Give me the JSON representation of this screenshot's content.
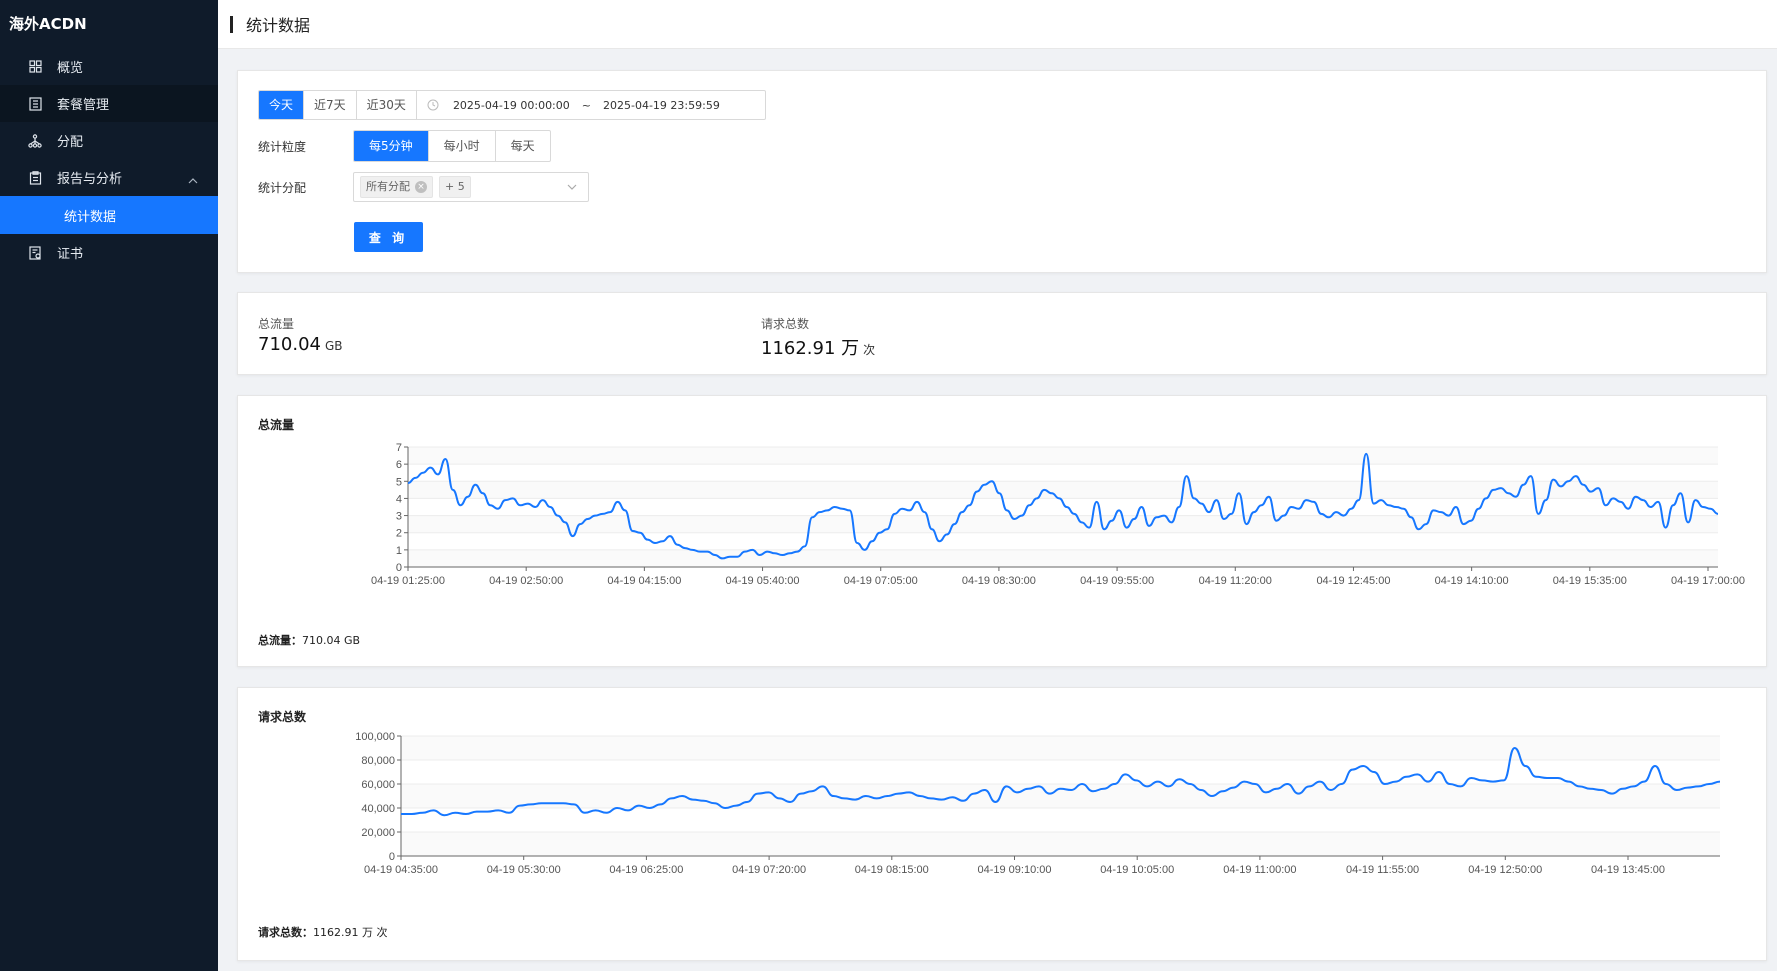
{
  "sidebar": {
    "brand": "海外ACDN",
    "items": [
      {
        "label": "概览",
        "icon": "grid-icon"
      },
      {
        "label": "套餐管理",
        "icon": "document-list-icon"
      },
      {
        "label": "分配",
        "icon": "hierarchy-icon"
      },
      {
        "label": "报告与分析",
        "icon": "clipboard-icon"
      },
      {
        "label": "统计数据",
        "icon": ""
      },
      {
        "label": "证书",
        "icon": "certificate-icon"
      }
    ]
  },
  "header": {
    "title": "统计数据"
  },
  "filters": {
    "ranges": [
      "今天",
      "近7天",
      "近30天"
    ],
    "start": "2025-04-19 00:00:00",
    "separator": "~",
    "end": "2025-04-19 23:59:59",
    "granularity_label": "统计粒度",
    "granularities": [
      "每5分钟",
      "每小时",
      "每天"
    ],
    "distribution_label": "统计分配",
    "distribution_tag": "所有分配",
    "distribution_more": "+ 5",
    "query_label": "查 询"
  },
  "summary": {
    "traffic_label": "总流量",
    "traffic_value": "710.04",
    "traffic_unit": "GB",
    "requests_label": "请求总数",
    "requests_value": "1162.91 万",
    "requests_unit": "次"
  },
  "chart_data": [
    {
      "type": "line",
      "title": "总流量",
      "ylim": [
        0,
        7
      ],
      "yticks": [
        "0",
        "1",
        "2",
        "3",
        "4",
        "5",
        "6",
        "7"
      ],
      "xticks": [
        "04-19 01:25:00",
        "04-19 02:50:00",
        "04-19 04:15:00",
        "04-19 05:40:00",
        "04-19 07:05:00",
        "04-19 08:30:00",
        "04-19 09:55:00",
        "04-19 11:20:00",
        "04-19 12:45:00",
        "04-19 14:10:00",
        "04-19 15:35:00",
        "04-19 17:00:00"
      ],
      "color": "#1677ff",
      "values": [
        4.9,
        5.2,
        5.5,
        5.8,
        5.4,
        6.3,
        4.5,
        3.6,
        4.1,
        4.8,
        4.3,
        3.6,
        3.4,
        3.9,
        4.0,
        3.6,
        3.7,
        3.5,
        3.9,
        3.5,
        3.0,
        2.6,
        1.8,
        2.5,
        2.8,
        3.0,
        3.1,
        3.2,
        3.8,
        3.3,
        2.1,
        2.0,
        1.6,
        1.4,
        1.5,
        1.8,
        1.3,
        1.1,
        1.0,
        0.9,
        0.9,
        0.7,
        0.5,
        0.6,
        0.6,
        0.9,
        1.0,
        0.7,
        0.9,
        0.8,
        0.7,
        0.8,
        0.9,
        1.2,
        2.9,
        3.2,
        3.3,
        3.5,
        3.4,
        3.3,
        1.4,
        1.0,
        1.5,
        2.0,
        2.2,
        3.1,
        3.4,
        3.3,
        3.8,
        3.2,
        2.2,
        1.5,
        1.9,
        2.5,
        3.2,
        3.6,
        4.4,
        4.8,
        5.0,
        4.3,
        3.3,
        2.8,
        3.0,
        3.6,
        4.0,
        4.5,
        4.3,
        4.0,
        3.5,
        3.1,
        2.6,
        2.3,
        3.8,
        2.2,
        2.7,
        3.3,
        2.3,
        2.8,
        3.5,
        2.4,
        2.9,
        3.0,
        2.6,
        3.5,
        5.3,
        4.0,
        3.7,
        3.2,
        3.9,
        2.8,
        3.1,
        4.3,
        2.5,
        3.2,
        3.6,
        4.1,
        2.7,
        3.0,
        3.5,
        3.4,
        3.9,
        3.8,
        3.1,
        2.9,
        3.2,
        3.0,
        3.4,
        3.9,
        6.6,
        3.7,
        3.9,
        3.6,
        3.5,
        3.4,
        2.9,
        2.2,
        2.5,
        3.3,
        3.2,
        3.0,
        3.5,
        2.5,
        2.7,
        3.4,
        4.0,
        4.5,
        4.6,
        4.3,
        4.1,
        4.8,
        5.3,
        3.1,
        3.9,
        5.1,
        4.7,
        5.0,
        5.3,
        4.8,
        4.4,
        4.6,
        3.6,
        4.0,
        3.8,
        3.4,
        4.1,
        3.9,
        3.5,
        3.8,
        2.3,
        3.6,
        4.3,
        2.6,
        3.9,
        3.5,
        3.4,
        3.1
      ],
      "footer_label": "总流量：",
      "footer_value": "710.04 GB"
    },
    {
      "type": "line",
      "title": "请求总数",
      "ylim": [
        0,
        100000
      ],
      "yticks": [
        "0",
        "20,000",
        "40,000",
        "60,000",
        "80,000",
        "100,000"
      ],
      "xticks": [
        "04-19 04:35:00",
        "04-19 05:30:00",
        "04-19 06:25:00",
        "04-19 07:20:00",
        "04-19 08:15:00",
        "04-19 09:10:00",
        "04-19 10:05:00",
        "04-19 11:00:00",
        "04-19 11:55:00",
        "04-19 12:50:00",
        "04-19 13:45:00"
      ],
      "color": "#1677ff",
      "values": [
        35000,
        35000,
        36000,
        38000,
        34000,
        36000,
        35000,
        37000,
        37000,
        38000,
        36000,
        42000,
        43000,
        44000,
        44000,
        44000,
        43000,
        36000,
        38000,
        36000,
        40000,
        38000,
        42000,
        40000,
        43000,
        48000,
        50000,
        47000,
        46000,
        44000,
        40000,
        42000,
        45000,
        52000,
        53000,
        48000,
        45000,
        52000,
        54000,
        58000,
        50000,
        48000,
        47000,
        50000,
        48000,
        50000,
        52000,
        53000,
        50000,
        48000,
        47000,
        49000,
        46000,
        52000,
        55000,
        45000,
        58000,
        53000,
        56000,
        58000,
        52000,
        56000,
        55000,
        60000,
        54000,
        56000,
        60000,
        68000,
        63000,
        58000,
        62000,
        58000,
        64000,
        60000,
        55000,
        50000,
        54000,
        57000,
        62000,
        60000,
        53000,
        56000,
        60000,
        52000,
        58000,
        62000,
        55000,
        60000,
        72000,
        75000,
        70000,
        60000,
        62000,
        66000,
        68000,
        62000,
        70000,
        60000,
        58000,
        65000,
        63000,
        62000,
        63000,
        90000,
        75000,
        66000,
        65000,
        65000,
        62000,
        58000,
        56000,
        55000,
        52000,
        56000,
        58000,
        62000,
        75000,
        60000,
        55000,
        57000,
        58000,
        60000,
        62000
      ],
      "footer_label": "请求总数：",
      "footer_value": "1162.91 万 次"
    }
  ]
}
